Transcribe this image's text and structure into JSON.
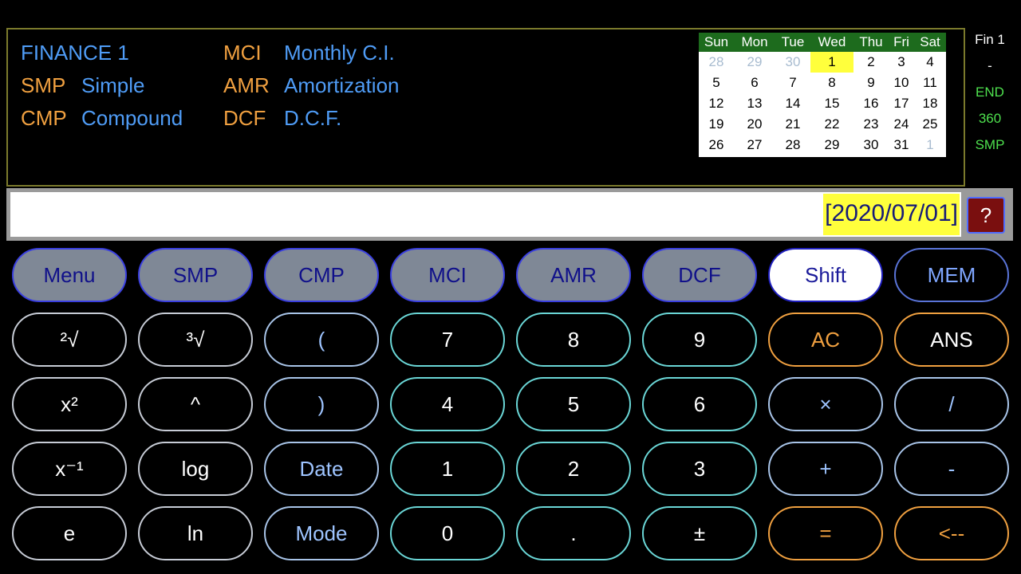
{
  "menu": {
    "title": "FINANCE 1",
    "items": [
      {
        "code": "SMP",
        "label": "Simple"
      },
      {
        "code": "CMP",
        "label": "Compound"
      },
      {
        "code": "MCI",
        "label": "Monthly C.I."
      },
      {
        "code": "AMR",
        "label": "Amortization"
      },
      {
        "code": "DCF",
        "label": "D.C.F."
      }
    ]
  },
  "calendar": {
    "days": [
      "Sun",
      "Mon",
      "Tue",
      "Wed",
      "Thu",
      "Fri",
      "Sat"
    ],
    "weeks": [
      [
        "28",
        "29",
        "30",
        "1",
        "2",
        "3",
        "4"
      ],
      [
        "5",
        "6",
        "7",
        "8",
        "9",
        "10",
        "11"
      ],
      [
        "12",
        "13",
        "14",
        "15",
        "16",
        "17",
        "18"
      ],
      [
        "19",
        "20",
        "21",
        "22",
        "23",
        "24",
        "25"
      ],
      [
        "26",
        "27",
        "28",
        "29",
        "30",
        "31",
        "1"
      ]
    ],
    "today": "1"
  },
  "status": {
    "mode": "Fin 1",
    "indicator": "-",
    "timing": "END",
    "day_basis": "360",
    "interest": "SMP"
  },
  "display": {
    "value": "[2020/07/01]",
    "help_label": "?"
  },
  "keys": {
    "menu": "Menu",
    "smp": "SMP",
    "cmp": "CMP",
    "mci": "MCI",
    "amr": "AMR",
    "dcf": "DCF",
    "shift": "Shift",
    "mem": "MEM",
    "sqrt2": "²√",
    "sqrt3": "³√",
    "lparen": "(",
    "seven": "7",
    "eight": "8",
    "nine": "9",
    "ac": "AC",
    "ans": "ANS",
    "square": "x²",
    "power": "^",
    "rparen": ")",
    "four": "4",
    "five": "5",
    "six": "6",
    "multiply": "×",
    "divide": "/",
    "reciprocal": "x⁻¹",
    "log": "log",
    "date": "Date",
    "one": "1",
    "two": "2",
    "three": "3",
    "plus": "+",
    "minus": "-",
    "e": "e",
    "ln": "ln",
    "mode": "Mode",
    "zero": "0",
    "dot": ".",
    "plusminus": "±",
    "equals": "=",
    "backspace": "<--"
  },
  "colors": {
    "accent_orange": "#f0a040",
    "accent_blue": "#4f9cf6",
    "highlight_yellow": "#ffff3c",
    "calendar_header": "#1d6b1d",
    "status_green": "#4ee04e"
  }
}
